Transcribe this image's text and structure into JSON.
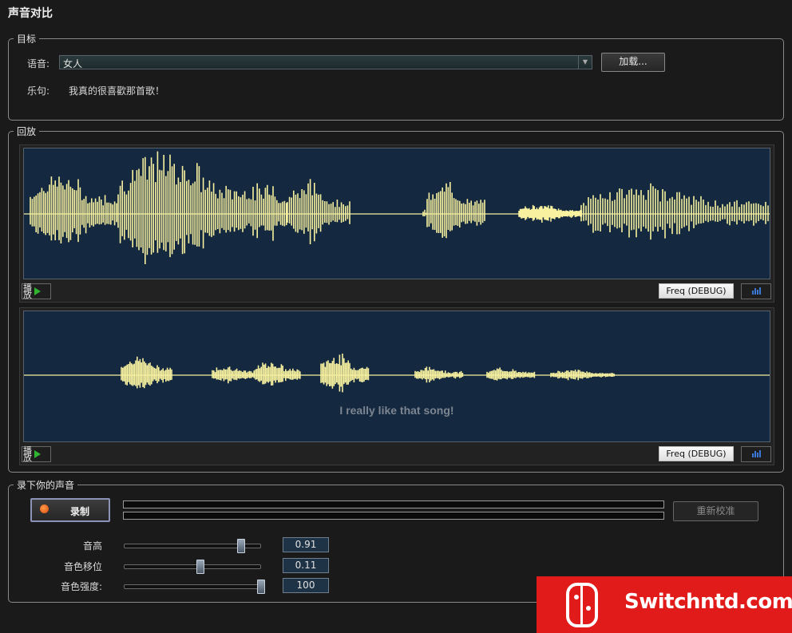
{
  "window": {
    "title": "声音对比"
  },
  "target": {
    "legend": "目标",
    "voice_label": "语音:",
    "voice_value": "女人",
    "load_button": "加载...",
    "phrase_label": "乐句:",
    "phrase_text": "我真的很喜歡那首歌！"
  },
  "playback": {
    "legend": "回放",
    "reference": {
      "play_label": "播放",
      "freq_button": "Freq (DEBUG)"
    },
    "user": {
      "play_label": "播放",
      "freq_button": "Freq (DEBUG)",
      "subtitle": "I really like that song!"
    },
    "colors": {
      "waveform": "#f8f2a0",
      "wave_bg": "#142840"
    }
  },
  "record": {
    "legend": "录下你的声音",
    "record_button": "录制",
    "recalibrate_button": "重新校准",
    "sliders": [
      {
        "name": "pitch",
        "label": "音高",
        "value": "0.91",
        "fraction": 0.85
      },
      {
        "name": "timbre-shift",
        "label": "音色移位",
        "value": "0.11",
        "fraction": 0.55
      },
      {
        "name": "timbre-strength",
        "label": "音色强度:",
        "value": "100",
        "fraction": 1.0
      }
    ]
  },
  "watermark": {
    "text": "Switchntd.com"
  }
}
